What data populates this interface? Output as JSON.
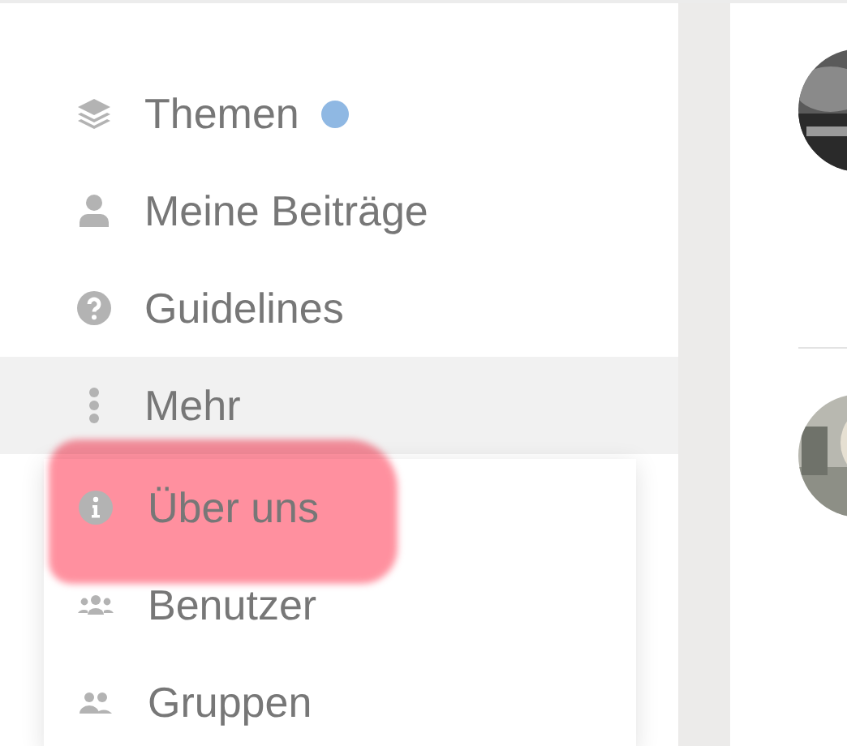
{
  "sidebar": {
    "items": [
      {
        "label": "Themen",
        "unread": true,
        "expanded": false
      },
      {
        "label": "Meine Beiträge",
        "unread": false,
        "expanded": false
      },
      {
        "label": "Guidelines",
        "unread": false,
        "expanded": false
      },
      {
        "label": "Mehr",
        "unread": false,
        "expanded": true
      }
    ]
  },
  "more_menu": {
    "items": [
      {
        "label": "Über uns",
        "highlighted": true
      },
      {
        "label": "Benutzer",
        "highlighted": false
      },
      {
        "label": "Gruppen",
        "highlighted": false
      }
    ]
  }
}
